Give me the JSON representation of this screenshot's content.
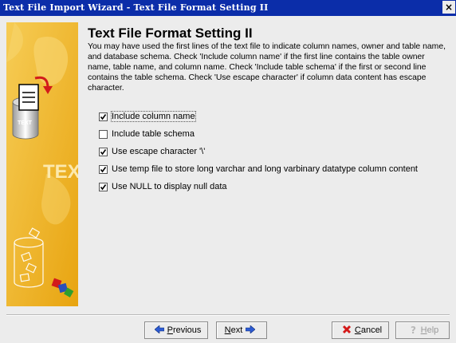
{
  "window": {
    "title": "Text File Import Wizard - Text File Format Setting II",
    "close_label": "×"
  },
  "left_panel": {
    "text_small": "TEXT",
    "text_large": "TEXT",
    "bg_color": "#f0b41c"
  },
  "main": {
    "heading": "Text File Format Setting II",
    "description": "You may have used the first lines of the text file to indicate column names, owner and table name, and database schema. Check 'Include column name' if the first line contains the table owner name, table name, and column name. Check 'Include table schema' if the first or second line contains the table schema. Check 'Use escape character' if column data content has escape character.",
    "options": [
      {
        "label": "Include column name",
        "checked": true
      },
      {
        "label": "Include table schema",
        "checked": false
      },
      {
        "label": "Use escape character '\\'",
        "checked": true
      },
      {
        "label": "Use temp file to store long varchar and long varbinary datatype column content",
        "checked": true
      },
      {
        "label": "Use NULL to display null data",
        "checked": true
      }
    ]
  },
  "buttons": {
    "previous": {
      "prefix": "",
      "mnemonic": "P",
      "rest": "revious"
    },
    "next": {
      "prefix": "",
      "mnemonic": "N",
      "rest": "ext"
    },
    "cancel": {
      "prefix": "",
      "mnemonic": "C",
      "rest": "ancel"
    },
    "help": {
      "prefix": "",
      "mnemonic": "H",
      "rest": "elp"
    }
  }
}
